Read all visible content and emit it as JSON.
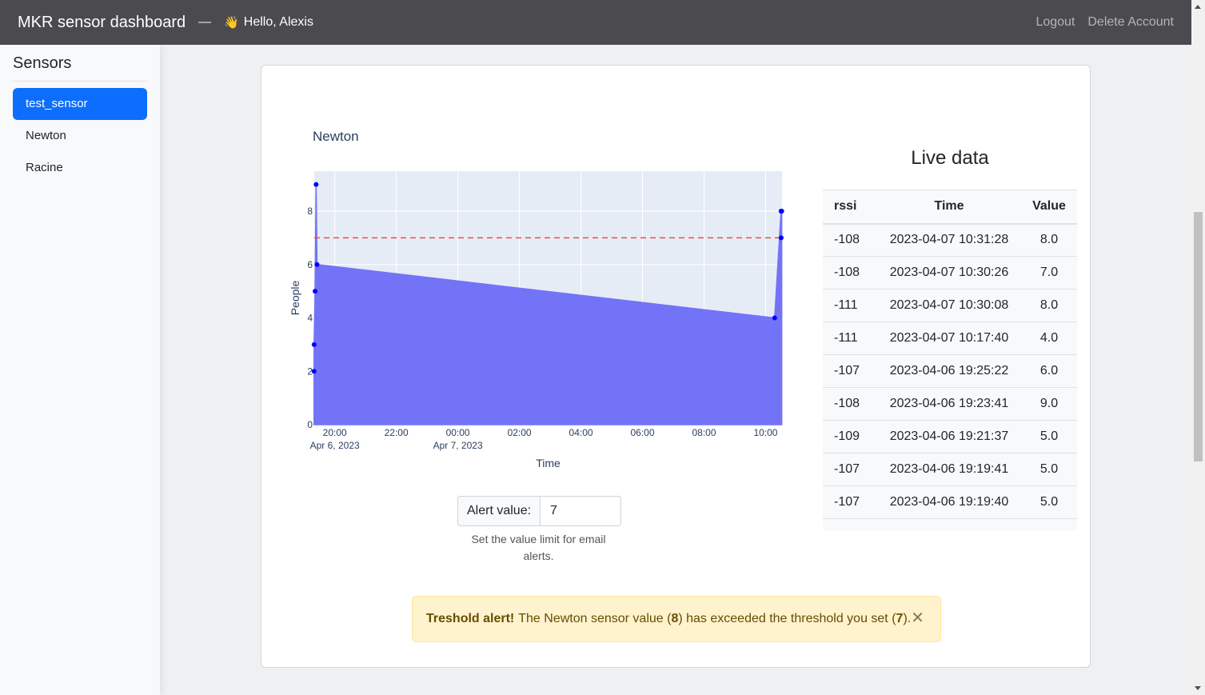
{
  "nav": {
    "brand": "MKR sensor dashboard",
    "separator": "—",
    "wave": "👋",
    "greeting": "Hello, Alexis",
    "logout": "Logout",
    "delete": "Delete Account"
  },
  "sidebar": {
    "title": "Sensors",
    "items": [
      {
        "label": "test_sensor",
        "active": true
      },
      {
        "label": "Newton",
        "active": false
      },
      {
        "label": "Racine",
        "active": false
      }
    ]
  },
  "chart_data": {
    "type": "area",
    "title": "Newton",
    "xlabel": "Time",
    "ylabel": "People",
    "ylim": [
      0,
      9.5
    ],
    "xlim": [
      "2023-04-06 19:20",
      "2023-04-07 10:32"
    ],
    "x_ticks": [
      {
        "t": "2023-04-06 20:00",
        "label": "20:00",
        "sub": "Apr 6, 2023"
      },
      {
        "t": "2023-04-06 22:00",
        "label": "22:00",
        "sub": ""
      },
      {
        "t": "2023-04-07 00:00",
        "label": "00:00",
        "sub": "Apr 7, 2023"
      },
      {
        "t": "2023-04-07 02:00",
        "label": "02:00",
        "sub": ""
      },
      {
        "t": "2023-04-07 04:00",
        "label": "04:00",
        "sub": ""
      },
      {
        "t": "2023-04-07 06:00",
        "label": "06:00",
        "sub": ""
      },
      {
        "t": "2023-04-07 08:00",
        "label": "08:00",
        "sub": ""
      },
      {
        "t": "2023-04-07 10:00",
        "label": "10:00",
        "sub": ""
      }
    ],
    "y_ticks": [
      0,
      2,
      4,
      6,
      8
    ],
    "threshold": 7,
    "x": [
      "2023-04-06 19:19:40",
      "2023-04-06 19:19:41",
      "2023-04-06 19:21:37",
      "2023-04-06 19:23:41",
      "2023-04-06 19:25:22",
      "2023-04-07 10:17:40",
      "2023-04-07 10:30:08",
      "2023-04-07 10:30:26",
      "2023-04-07 10:31:28"
    ],
    "y": [
      2,
      3,
      5,
      9,
      6,
      4,
      8,
      7,
      8
    ],
    "fill_color": "#7373f7",
    "point_color": "#0000ff",
    "threshold_color": "#ef4c4c",
    "plot_bg": "#e5ecf6"
  },
  "alert_input": {
    "label": "Alert value:",
    "value": "7",
    "help": "Set the value limit for email alerts."
  },
  "live": {
    "title": "Live data",
    "headers": [
      "rssi",
      "Time",
      "Value"
    ],
    "rows": [
      [
        "-108",
        "2023-04-07 10:31:28",
        "8.0"
      ],
      [
        "-108",
        "2023-04-07 10:30:26",
        "7.0"
      ],
      [
        "-111",
        "2023-04-07 10:30:08",
        "8.0"
      ],
      [
        "-111",
        "2023-04-07 10:17:40",
        "4.0"
      ],
      [
        "-107",
        "2023-04-06 19:25:22",
        "6.0"
      ],
      [
        "-108",
        "2023-04-06 19:23:41",
        "9.0"
      ],
      [
        "-109",
        "2023-04-06 19:21:37",
        "5.0"
      ],
      [
        "-107",
        "2023-04-06 19:19:41",
        "5.0"
      ],
      [
        "-107",
        "2023-04-06 19:19:40",
        "5.0"
      ]
    ]
  },
  "alert": {
    "strong": "Treshold alert!",
    "text_before": "The Newton sensor value (",
    "value": "8",
    "text_middle": ") has exceeded the threshold you set (",
    "threshold": "7",
    "text_after": ").",
    "close": "✕"
  }
}
